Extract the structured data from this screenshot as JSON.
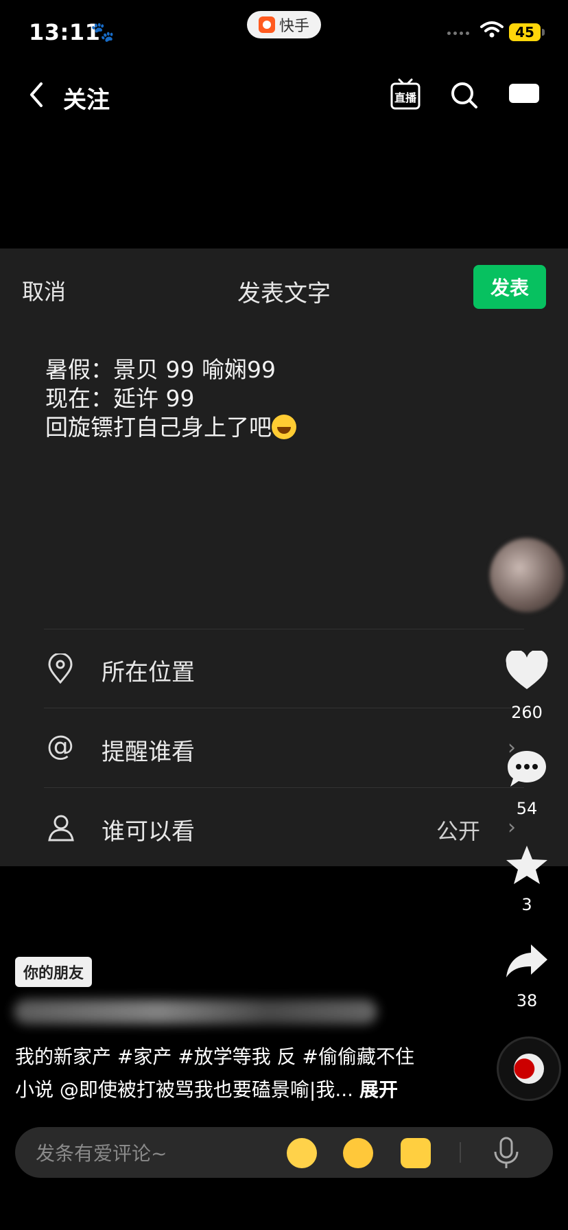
{
  "status_bar": {
    "time": "13:11",
    "paw": "🐾",
    "app_name": "快手",
    "battery": "45"
  },
  "top_nav": {
    "back_label": "关注",
    "live_label": "直播"
  },
  "compose": {
    "cancel": "取消",
    "title": "发表文字",
    "publish": "发表",
    "lines": [
      "暑假：景贝 99 喻娴99",
      "现在：延许 99",
      "回旋镖打自己身上了吧"
    ],
    "options": [
      {
        "label": "所在位置",
        "value": "",
        "icon": "location-pin-icon"
      },
      {
        "label": "提醒谁看",
        "value": "",
        "icon": "at-icon"
      },
      {
        "label": "谁可以看",
        "value": "公开",
        "icon": "person-icon"
      }
    ]
  },
  "rail": {
    "likes": "260",
    "comments": "54",
    "favorites": "3",
    "shares": "38"
  },
  "post": {
    "friend_tag": "你的朋友",
    "caption_line1": "我的新家产 #家产 #放学等我 反 #偷偷藏不住",
    "caption_line2": "小说 @即使被打被骂我也要磕景喻|我... ",
    "expand": "展开"
  },
  "comment_bar": {
    "placeholder": "发条有爱评论~"
  },
  "colors": {
    "publish_green": "#07c160",
    "sheet_bg": "#1f1f1f",
    "battery_yellow": "#ffd60a"
  }
}
